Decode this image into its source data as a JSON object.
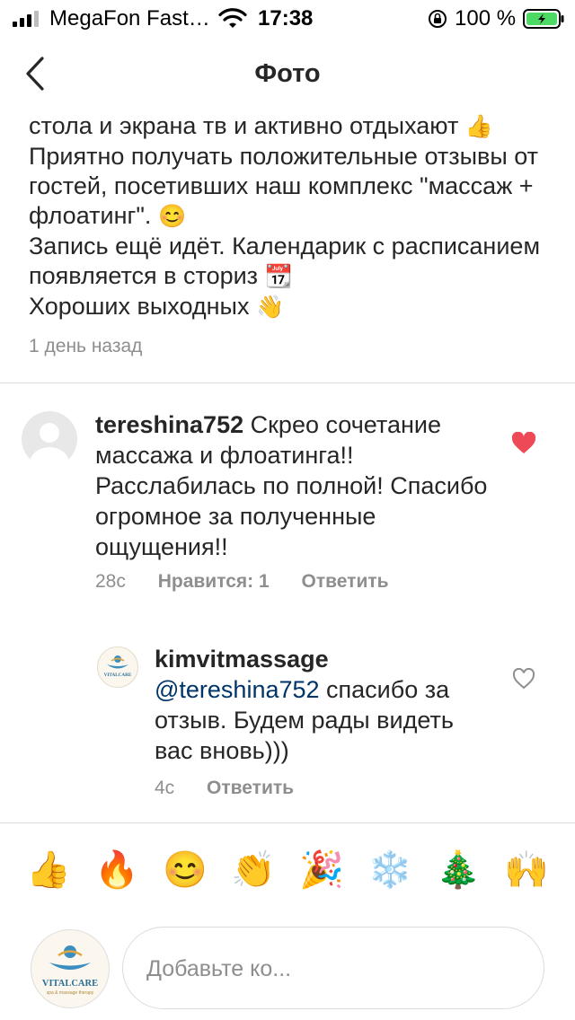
{
  "status_bar": {
    "carrier": "MegaFon Fast…",
    "time": "17:38",
    "battery_percent": "100 %"
  },
  "nav": {
    "title": "Фото"
  },
  "caption": {
    "line1": "стола и экрана тв и активно отдыхают",
    "line1_emoji": "👍",
    "line2": "Приятно получать положительные отзывы от гостей, посетивших наш комплекс \"массаж + флоатинг\".",
    "line2_emoji": "😊",
    "line3": "Запись ещё идёт. Календарик с расписанием появляется в сториз",
    "line3_emoji": "📆",
    "line4": "Хороших выходных",
    "line4_emoji": "👋",
    "time": "1 день назад"
  },
  "comments": [
    {
      "username": "tereshina752",
      "text": "Скрео сочетание массажа и флоатинга!! Расслабилась по полной! Спасибо огромное за полученные ощущения!!",
      "time": "28с",
      "likes": "Нравится: 1",
      "reply_label": "Ответить",
      "liked": true
    },
    {
      "username": "kimvitmassage",
      "mention": "@tereshina752",
      "text": "спасибо за отзыв. Будем рады видеть вас вновь)))",
      "time": "4с",
      "reply_label": "Ответить",
      "liked": false,
      "logo_text": "VITALCARE"
    }
  ],
  "emoji_bar": [
    "👍",
    "🔥",
    "😊",
    "👏",
    "🎉",
    "❄️",
    "🎄",
    "🙌"
  ],
  "composer": {
    "placeholder": "Добавьте ко...",
    "logo_text": "VITALCARE",
    "logo_subtext": "spa & massage therapy"
  },
  "colors": {
    "like_red": "#ed4956",
    "mention_blue": "#003569",
    "secondary_text": "#8e8e8e"
  }
}
